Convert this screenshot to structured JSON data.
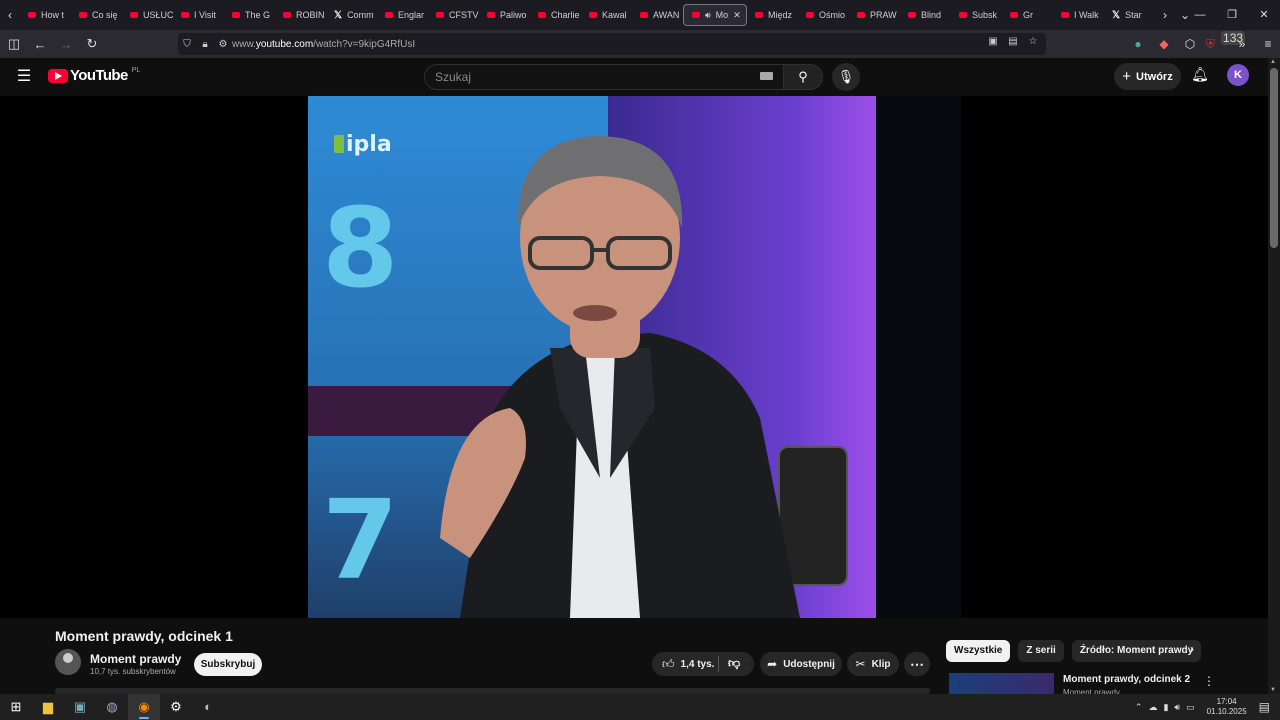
{
  "browser": {
    "tabs": [
      {
        "label": "How t",
        "icon": "yt"
      },
      {
        "label": "Co się",
        "icon": "yt"
      },
      {
        "label": "USŁUC",
        "icon": "yt"
      },
      {
        "label": "I Visit",
        "icon": "yt"
      },
      {
        "label": "The G",
        "icon": "yt"
      },
      {
        "label": "ROBIN",
        "icon": "yt"
      },
      {
        "label": "Comm",
        "icon": "x"
      },
      {
        "label": "Englar",
        "icon": "yt"
      },
      {
        "label": "CFSTV",
        "icon": "yt"
      },
      {
        "label": "Paliwo",
        "icon": "yt"
      },
      {
        "label": "Charlie",
        "icon": "yt"
      },
      {
        "label": "Kawal",
        "icon": "yt"
      },
      {
        "label": "AWAN",
        "icon": "yt"
      },
      {
        "label": "Mo",
        "icon": "yt",
        "active": true
      },
      {
        "label": "Międz",
        "icon": "yt"
      },
      {
        "label": "Ośmio",
        "icon": "yt"
      },
      {
        "label": "PRAW",
        "icon": "yt"
      },
      {
        "label": "Blind",
        "icon": "yt"
      },
      {
        "label": "Subsk",
        "icon": "yt"
      },
      {
        "label": "Gr",
        "icon": "yt"
      },
      {
        "label": "I Walk",
        "icon": "yt"
      },
      {
        "label": "Star",
        "icon": "x"
      }
    ],
    "url_prefix": "www.",
    "url_host": "youtube.com",
    "url_path": "/watch?v=9kipG4RfUsI",
    "ext_badge": "133"
  },
  "youtube": {
    "logo_text": "YouTube",
    "country_code": "PL",
    "search_placeholder": "Szukaj",
    "create_label": "Utwórz",
    "avatar_letter": "K"
  },
  "video": {
    "overlay_logo": "ipla",
    "title": "Moment prawdy, odcinek 1",
    "channel": "Moment prawdy",
    "subscribers": "10,7 tys. subskrybentów",
    "subscribe_label": "Subskrybuj",
    "likes": "1,4 tys.",
    "share_label": "Udostępnij",
    "clip_label": "Klip"
  },
  "sidebar": {
    "chips": [
      "Wszystkie",
      "Z serii",
      "Źródło: Moment prawdy"
    ],
    "next_video": {
      "title": "Moment prawdy, odcinek 2",
      "channel": "Moment prawdy"
    }
  },
  "taskbar": {
    "time": "17:04",
    "date": "01.10.2025"
  }
}
